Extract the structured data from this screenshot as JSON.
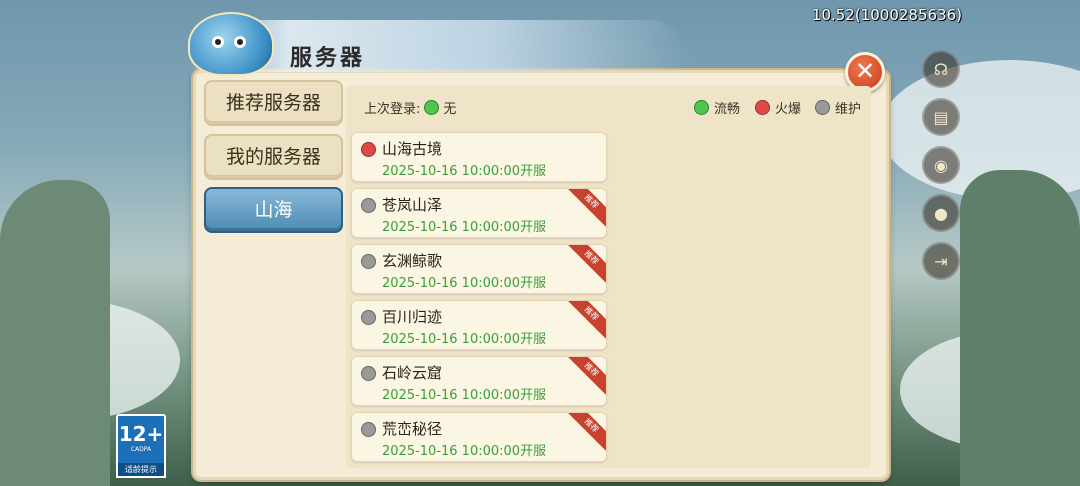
{
  "version_text": "10.52(1000285636)",
  "panel": {
    "title": "服务器",
    "close_glyph": "✕"
  },
  "tabs": [
    {
      "label": "推荐服务器",
      "active": false
    },
    {
      "label": "我的服务器",
      "active": false
    },
    {
      "label": "山海",
      "active": true
    }
  ],
  "last_login": {
    "label": "上次登录:",
    "value": "无",
    "status_color": "#4cc64c"
  },
  "legend": [
    {
      "label": "流畅",
      "color": "#4cc64c"
    },
    {
      "label": "火爆",
      "color": "#e04848"
    },
    {
      "label": "维护",
      "color": "#9a9a9a"
    }
  ],
  "servers": [
    {
      "name": "山海古境",
      "time": "2025-10-16 10:00:00开服",
      "status_color": "#e04848",
      "badge": ""
    },
    {
      "name": "苍岚山泽",
      "time": "2025-10-16 10:00:00开服",
      "status_color": "#9a9a9a",
      "badge": "推荐"
    },
    {
      "name": "玄渊鲸歌",
      "time": "2025-10-16 10:00:00开服",
      "status_color": "#9a9a9a",
      "badge": "推荐"
    },
    {
      "name": "百川归迹",
      "time": "2025-10-16 10:00:00开服",
      "status_color": "#9a9a9a",
      "badge": "推荐"
    },
    {
      "name": "石岭云窟",
      "time": "2025-10-16 10:00:00开服",
      "status_color": "#9a9a9a",
      "badge": "推荐"
    },
    {
      "name": "荒峦秘径",
      "time": "2025-10-16 10:00:00开服",
      "status_color": "#9a9a9a",
      "badge": "推荐"
    }
  ],
  "side_buttons": [
    {
      "icon": "headset-icon",
      "glyph": "☊"
    },
    {
      "icon": "document-icon",
      "glyph": "▤"
    },
    {
      "icon": "sound-icon",
      "glyph": "◉"
    },
    {
      "icon": "user-icon",
      "glyph": "●"
    },
    {
      "icon": "exit-icon",
      "glyph": "⇥"
    }
  ],
  "age_rating": {
    "age": "12+",
    "org": "CADPA",
    "tip": "适龄提示"
  },
  "colors": {
    "tab_active": "#4d8ab2",
    "close_button": "#c93a1a",
    "time_text": "#39a13a"
  }
}
